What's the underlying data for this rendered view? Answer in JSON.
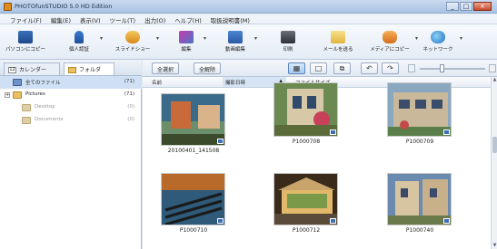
{
  "window": {
    "title": "PHOTOfunSTUDIO 5.0 HD Edition",
    "controls": [
      "_",
      "□",
      "×"
    ]
  },
  "menu": [
    "ファイル(F)",
    "編集(E)",
    "表示(V)",
    "ツール(T)",
    "出力(O)",
    "ヘルプ(H)",
    "取扱説明書(M)"
  ],
  "toolbar": [
    {
      "label": "パソコンにコピー",
      "icon": "copy-to-pc-icon"
    },
    {
      "label": "個人認証",
      "icon": "person-icon"
    },
    {
      "label": "スライドショー",
      "icon": "slideshow-icon"
    },
    {
      "label": "編集",
      "icon": "edit-icon"
    },
    {
      "label": "動画編集",
      "icon": "video-edit-icon"
    },
    {
      "label": "印刷",
      "icon": "print-icon"
    },
    {
      "label": "メールを送る",
      "icon": "mail-icon"
    },
    {
      "label": "メディアにコピー",
      "icon": "media-copy-icon"
    },
    {
      "label": "ネットワーク",
      "icon": "network-icon"
    }
  ],
  "left_tabs": {
    "calendar": "カレンダー",
    "calendar_num": "12",
    "folder": "フォルダ"
  },
  "tree": [
    {
      "label": "全てのファイル",
      "count": "(71)"
    },
    {
      "label": "Pictures",
      "count": "(71)"
    },
    {
      "label": "Desktop",
      "count": "(0)"
    },
    {
      "label": "Documents",
      "count": "(0)"
    }
  ],
  "content_toolbar": {
    "select_all": "全選択",
    "deselect_all": "全解除"
  },
  "columns": {
    "name": "名前",
    "date": "撮影日時",
    "size": "ファイルサイズ"
  },
  "thumbnails": [
    {
      "caption": "20100401_141508"
    },
    {
      "caption": "P1000708"
    },
    {
      "caption": "P1000709"
    },
    {
      "caption": "P1000710"
    },
    {
      "caption": "P1000712"
    },
    {
      "caption": "P1000740"
    }
  ],
  "colors": {
    "accent": "#3d6eb5",
    "selection": "#cfe0f5"
  }
}
